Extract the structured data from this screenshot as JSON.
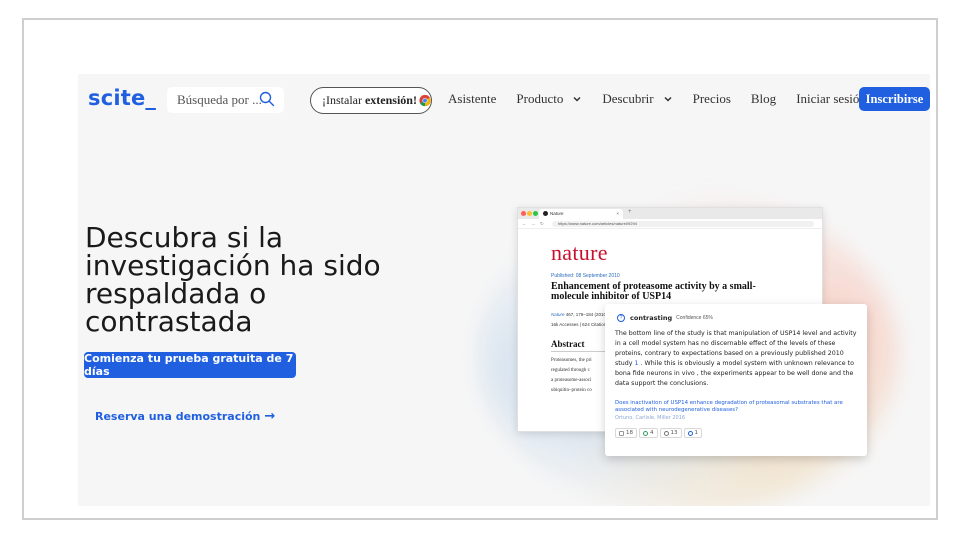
{
  "nav": {
    "logo": "scite_",
    "search_placeholder": "Búsqueda por ...",
    "extension": {
      "prefix": "¡Instalar",
      "bold": "extensión!"
    },
    "links": [
      {
        "label": "Asistente",
        "dropdown": false
      },
      {
        "label": "Producto",
        "dropdown": true
      },
      {
        "label": "Descubrir",
        "dropdown": true
      },
      {
        "label": "Precios",
        "dropdown": false
      },
      {
        "label": "Blog",
        "dropdown": false
      },
      {
        "label": "Iniciar sesión",
        "dropdown": false
      }
    ],
    "signup": "Inscribirse"
  },
  "hero": {
    "title": "Descubra si la investigación ha sido respaldada o contrastada",
    "cta": "Comienza tu prueba gratuita de 7 días",
    "demo": "Reserva una demostración",
    "demo_arrow": "→"
  },
  "browser": {
    "tab_title": "Nature",
    "tab_close": "×",
    "tab_plus": "+",
    "url": "https://www.nature.com/articles/nature09294",
    "journal_logo": "nature",
    "published": "Published: 08 September 2010",
    "article_title": "Enhancement of proteasome activity by a small-molecule inhibitor of USP14",
    "meta_journal": "Nature",
    "meta_rest": " 467, 179–184 (2010)",
    "meta_stats": "16k Accesses | 624 Citations",
    "abstract_heading": "Abstract",
    "abstract_lines": [
      "Proteasomes, the pri",
      "regulated through c",
      "a proteasome-associ",
      "ubiquitin–protein co"
    ]
  },
  "card": {
    "type": "contrasting",
    "confidence": "Confidence 65%",
    "text_before": "The bottom line of the study is that manipulation of USP14 level and activity in a cell model system has no discernable effect of the levels of these proteins, contrary to expectations based on a previously published 2010 study ",
    "ref": "1",
    "text_after": " . While this is obviously a model system with unknown relevance to bona fide neurons in vivo , the experiments appear to be well done and the data support the conclusions.",
    "question": "Does inactivation of USP14 enhance degradation of proteasomal substrates that are associated with neurodegenerative diseases?",
    "authors": "Ortuno, Carlisle, Miller 2016",
    "badges": [
      {
        "icon": "document-icon",
        "value": "18",
        "color": "#999999"
      },
      {
        "icon": "supporting-icon",
        "value": "4",
        "color": "#2e9e5b"
      },
      {
        "icon": "mentioning-icon",
        "value": "13",
        "color": "#777777"
      },
      {
        "icon": "contrasting-icon",
        "value": "1",
        "color": "#1f5fe0"
      }
    ]
  },
  "colors": {
    "brand_blue": "#1f5fe0",
    "nature_red": "#c8102e"
  }
}
